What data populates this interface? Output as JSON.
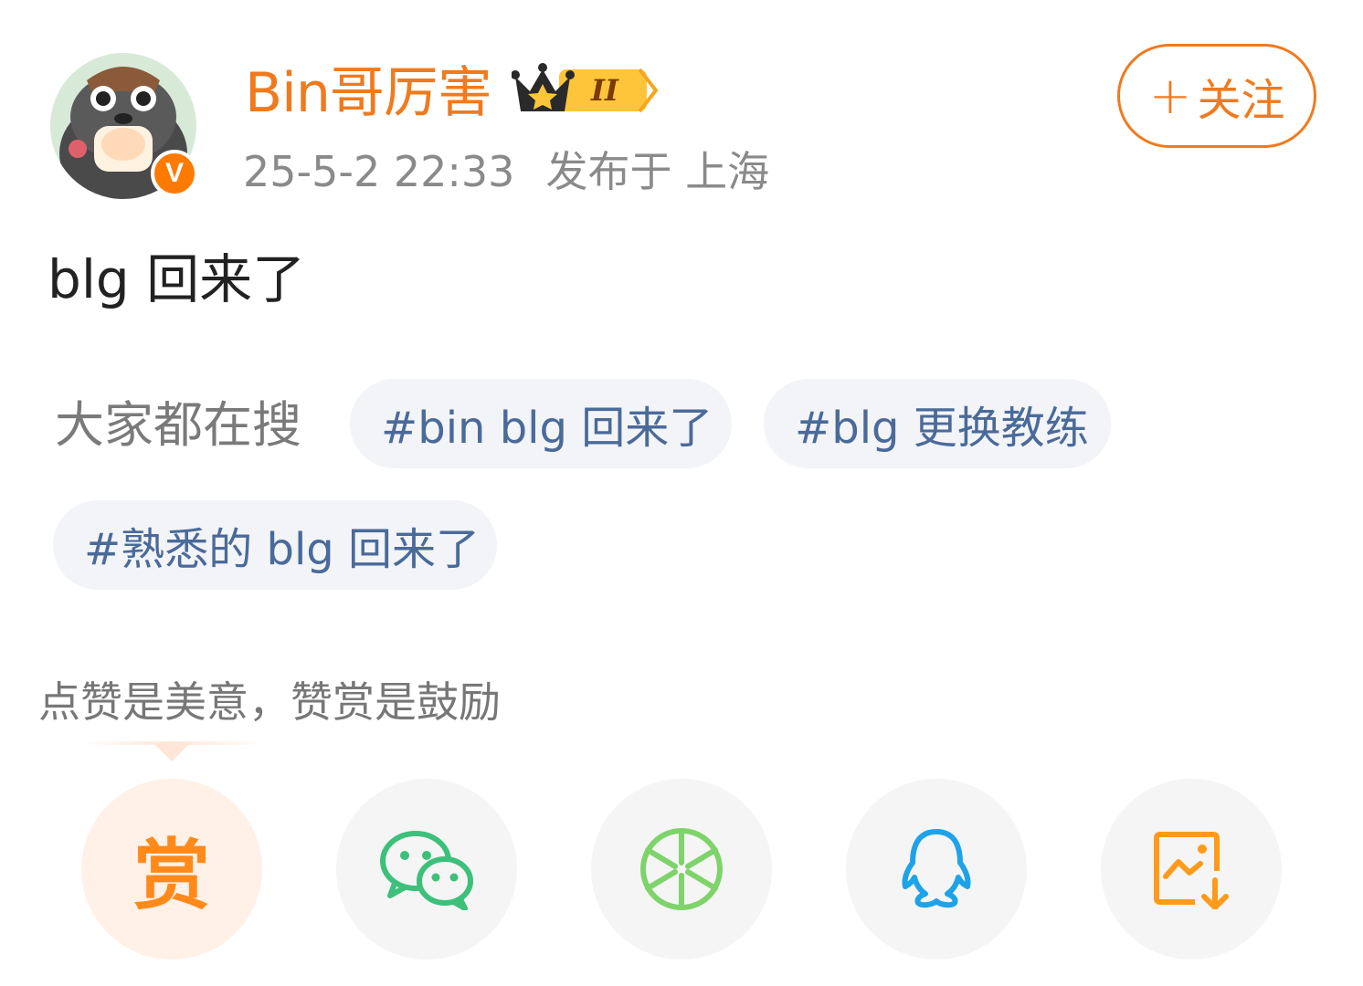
{
  "user": {
    "name": "Bin哥厉害",
    "level_badge": "II",
    "verified_mark": "V",
    "time": "25-5-2 22:33",
    "location": "发布于 上海",
    "follow_label": "关注",
    "follow_plus": "+"
  },
  "post": {
    "text": "blg 回来了"
  },
  "hot_search": {
    "label": "大家都在搜",
    "tags": [
      "#bin blg 回来了",
      "#blg 更换教练",
      "#熟悉的 blg 回来了"
    ]
  },
  "reward": {
    "caption": "点赞是美意，赞赏是鼓励",
    "button_char": "赏"
  },
  "share": {
    "icons": [
      "reward-icon",
      "wechat-icon",
      "moments-icon",
      "qq-icon",
      "save-image-icon"
    ]
  },
  "colors": {
    "accent": "#f07a1e",
    "tag_text": "#4a6a9a",
    "tag_bg": "#f2f4f7",
    "wechat": "#3cc07a",
    "moments": "#7ed36a",
    "qq": "#1fa3e8",
    "save": "#ff9a1a"
  }
}
